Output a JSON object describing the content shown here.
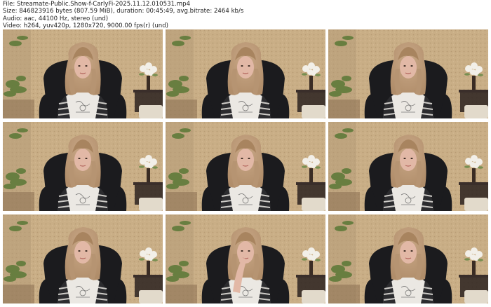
{
  "file_info": {
    "file_line": "File: Streamate-Public.Show-f-CarlyFi-2025.11.12.010531.mp4",
    "size_line": "Size: 846823916 bytes (807.59 MiB), duration: 00:45:49, avg.bitrate: 2464 kb/s",
    "audio_line": "Audio: aac, 44100 Hz, stereo (und)",
    "video_line": "Video: h264, yuv420p, 1280x720, 9000.00 fps(r) (und)"
  },
  "thumbnails": [
    {
      "id": 1,
      "variant": "front"
    },
    {
      "id": 2,
      "variant": "front"
    },
    {
      "id": 3,
      "variant": "front"
    },
    {
      "id": 4,
      "variant": "front"
    },
    {
      "id": 5,
      "variant": "front"
    },
    {
      "id": 6,
      "variant": "front"
    },
    {
      "id": 7,
      "variant": "front"
    },
    {
      "id": 8,
      "variant": "hand-on-face"
    },
    {
      "id": 9,
      "variant": "front"
    }
  ],
  "colors": {
    "wall": "#c9ae86",
    "hair": "#b08d6a",
    "chair": "#1b1b1e",
    "shirt": "#ebe8e3",
    "skin": "#e2b8a6",
    "plant": "#5f7a3a",
    "flowers": "#f2efe8"
  }
}
